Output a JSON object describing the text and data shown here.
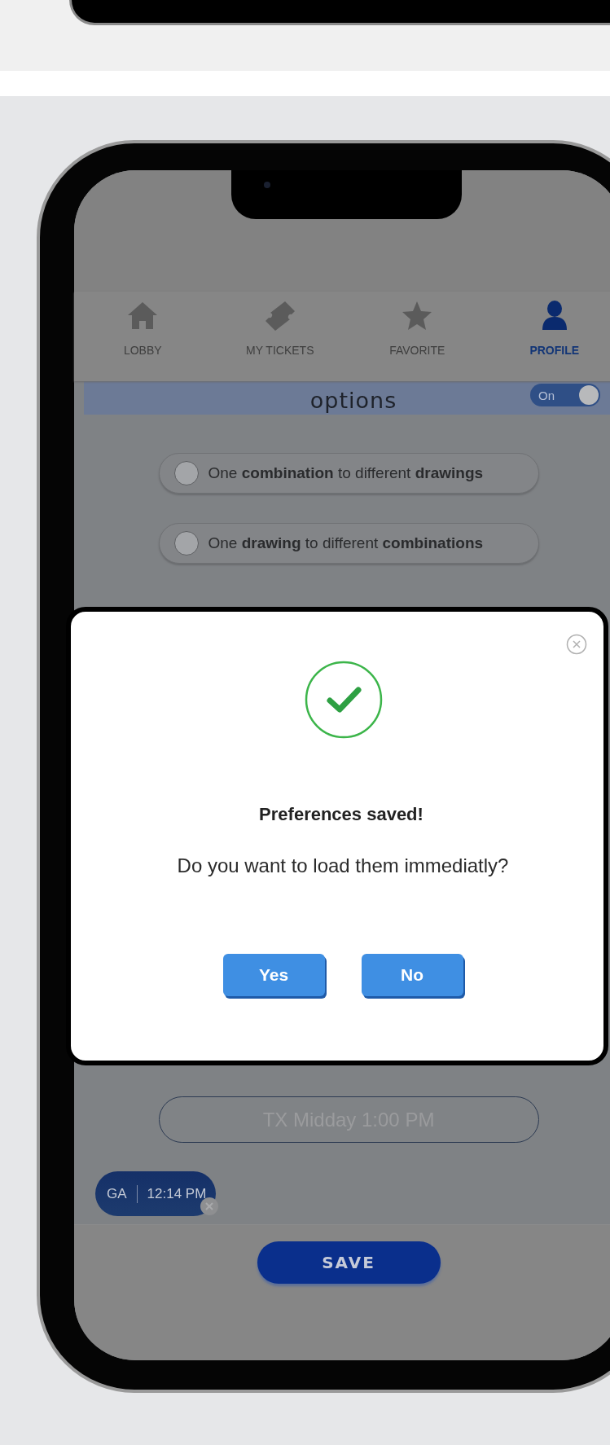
{
  "nav": {
    "tabs": [
      {
        "label": "LOBBY",
        "selected": false
      },
      {
        "label": "MY TICKETS",
        "selected": false
      },
      {
        "label": "FAVORITE",
        "selected": false
      },
      {
        "label": "PROFILE",
        "selected": true
      }
    ]
  },
  "header": {
    "title": "options",
    "toggle": {
      "label": "On",
      "on": true
    }
  },
  "options": [
    {
      "text": "One **combination** to different **drawings**",
      "selected": false
    },
    {
      "text": "One **drawing** to different **combinations**",
      "selected": false
    }
  ],
  "draw_field": {
    "placeholder": "TX Midday 1:00 PM"
  },
  "chip": {
    "state": "GA",
    "time": "12:14 PM"
  },
  "save_button": "SAVE",
  "dialog": {
    "title": "Preferences saved!",
    "message": "Do you want to load them immediatly?",
    "buttons": [
      "Yes",
      "No"
    ]
  }
}
